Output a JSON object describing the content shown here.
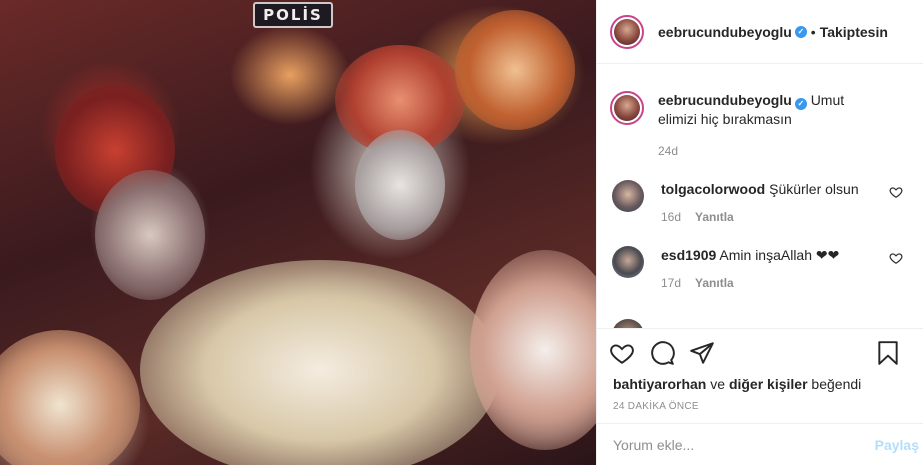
{
  "photo": {
    "badge_text": "POLİS",
    "alt_icon": "rescue-photo"
  },
  "header": {
    "username": "eebrucundubeyoglu",
    "separator": "•",
    "follow_state": "Takiptesin",
    "verified_icon": "verified-badge-icon"
  },
  "caption": {
    "username": "eebrucundubeyoglu",
    "text": "Umut elimizi hiç bırakmasın",
    "age": "24d"
  },
  "comments": [
    {
      "username": "tolgacolorwood",
      "text": "Şükürler olsun",
      "age": "16d",
      "reply_label": "Yanıtla"
    },
    {
      "username": "esd1909",
      "text": "Amin inşaAllah",
      "emoji": "❤❤",
      "age": "17d",
      "reply_label": "Yanıtla"
    }
  ],
  "likes": {
    "first_user": "bahtiyarorhan",
    "connector": "ve",
    "others": "diğer kişiler",
    "verb": "beğendi"
  },
  "time_ago": "24 DAKİKA ÖNCE",
  "comment_box": {
    "placeholder": "Yorum ekle...",
    "post_label": "Paylaş"
  },
  "colors": {
    "accent_blue": "#3897f0",
    "post_button_disabled": "#b2dffc",
    "secondary_text": "#8e8e8e",
    "story_ring": "#c8448a"
  }
}
